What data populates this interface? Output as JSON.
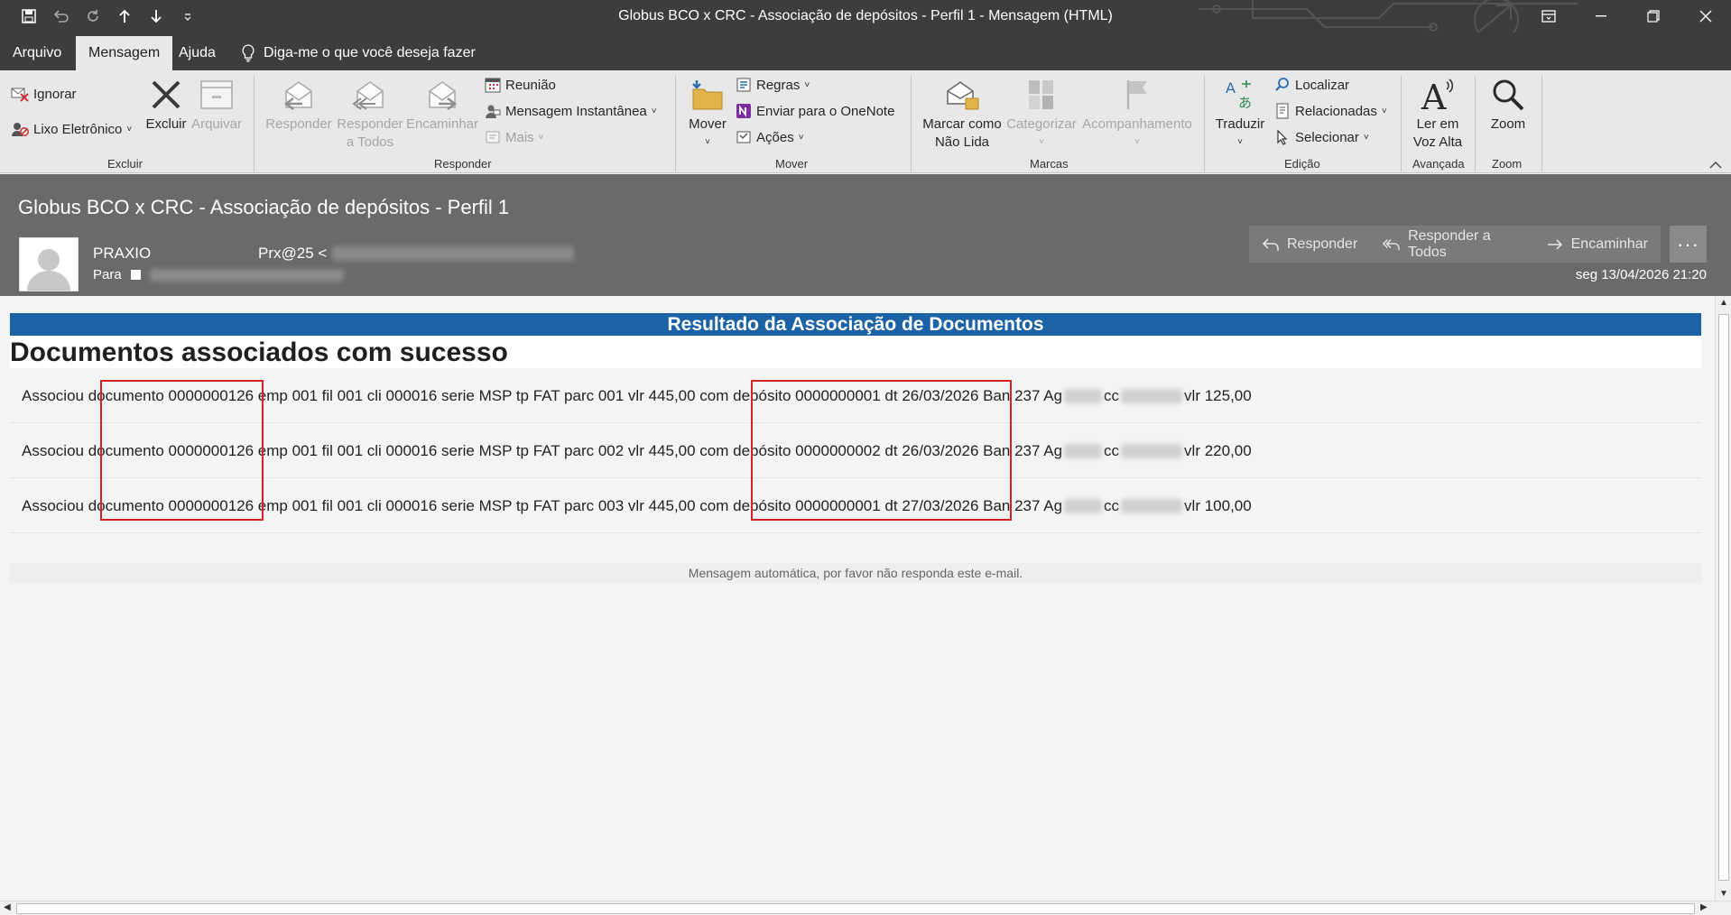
{
  "window": {
    "title": "Globus BCO x CRC - Associação de depósitos - Perfil 1  -  Mensagem (HTML)"
  },
  "menu": {
    "tabs": [
      "Arquivo",
      "Mensagem",
      "Ajuda"
    ],
    "tell_me": "Diga-me o que você deseja fazer"
  },
  "ribbon": {
    "excluir": {
      "ignorar": "Ignorar",
      "lixo": "Lixo Eletrônico",
      "excluir": "Excluir",
      "arquivar": "Arquivar",
      "label": "Excluir"
    },
    "responder": {
      "responder": "Responder",
      "responder_todos_1": "Responder",
      "responder_todos_2": "a Todos",
      "encaminhar": "Encaminhar",
      "reuniao": "Reunião",
      "mensagem_instantanea": "Mensagem Instantânea",
      "mais": "Mais",
      "label": "Responder"
    },
    "mover": {
      "mover": "Mover",
      "regras": "Regras",
      "onenote": "Enviar para o OneNote",
      "acoes": "Ações",
      "label": "Mover"
    },
    "marcas": {
      "marcar_1": "Marcar como",
      "marcar_2": "Não Lida",
      "categorizar": "Categorizar",
      "acompanhamento": "Acompanhamento",
      "label": "Marcas"
    },
    "edicao": {
      "traduzir": "Traduzir",
      "localizar": "Localizar",
      "relacionadas": "Relacionadas",
      "selecionar": "Selecionar",
      "label": "Edição"
    },
    "avancada": {
      "ler_1": "Ler em",
      "ler_2": "Voz Alta",
      "label": "Avançada"
    },
    "zoom": {
      "zoom": "Zoom",
      "label": "Zoom"
    }
  },
  "message": {
    "subject": "Globus BCO x CRC - Associação de depósitos - Perfil 1",
    "sender_name": "PRAXIO",
    "sender_addr": "Prx@25 <",
    "to_label": "Para",
    "date": "seg 13/04/2026 21:20",
    "actions": {
      "reply": "Responder",
      "reply_all": "Responder a Todos",
      "forward": "Encaminhar"
    }
  },
  "body": {
    "banner": "Resultado da Associação de Documentos",
    "heading": "Documentos associados com sucesso",
    "rows": [
      {
        "prefix": "Associou documento 0000000126 emp 001 fil 001 cli 000016 serie MSP tp FAT parc 001 vlr 445,00 com depósito 0000000001 dt 26/03/2026 Ban 237 Ag",
        "cc": "cc",
        "value": "vlr 125,00"
      },
      {
        "prefix": "Associou documento 0000000126 emp 001 fil 001 cli 000016 serie MSP tp FAT parc 002 vlr 445,00 com depósito 0000000002 dt 26/03/2026 Ban 237 Ag",
        "cc": "cc",
        "value": "vlr 220,00"
      },
      {
        "prefix": "Associou documento 0000000126 emp 001 fil 001 cli 000016 serie MSP tp FAT parc 003 vlr 445,00 com depósito 0000000001 dt 27/03/2026 Ban 237 Ag",
        "cc": "cc",
        "value": "vlr 100,00"
      }
    ],
    "footer": "Mensagem automática, por favor não responda este e-mail."
  },
  "colors": {
    "banner": "#1b63a5",
    "highlight_box": "#d32222",
    "header_bg": "#6a6a6a",
    "titlebar_bg": "#3d3d3d"
  }
}
